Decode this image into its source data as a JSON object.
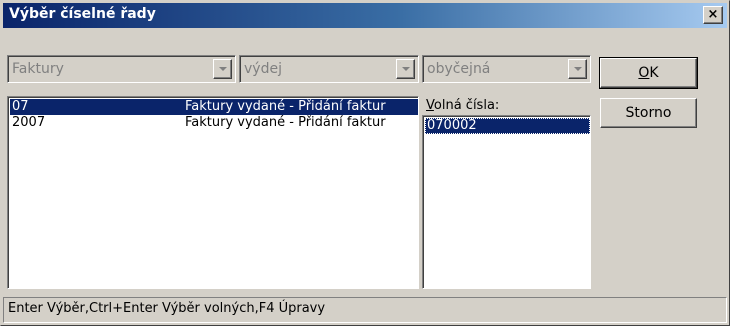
{
  "window": {
    "title": "Výběr číselné řady",
    "close_label": "×"
  },
  "filters": [
    {
      "value": "Faktury"
    },
    {
      "value": "výdej"
    },
    {
      "value": "obyčejná"
    }
  ],
  "buttons": {
    "ok_label": "OK",
    "storno_label": "Storno"
  },
  "series_list": {
    "rows": [
      {
        "code": "07",
        "description": "Faktury vydané - Přidání faktur",
        "selected": true
      },
      {
        "code": "2007",
        "description": "Faktury vydané - Přidání faktur",
        "selected": false
      }
    ]
  },
  "free_numbers": {
    "label": "Volná čísla:",
    "label_access_key": "V",
    "label_rest": "olná čísla:",
    "items": [
      "070002"
    ]
  },
  "statusbar": {
    "text": "Enter Výběr,Ctrl+Enter Výběr volných,F4 Úpravy"
  },
  "colors": {
    "title_bar": "#0a246a",
    "selection": "#0a246a",
    "face": "#d4d0c8"
  }
}
